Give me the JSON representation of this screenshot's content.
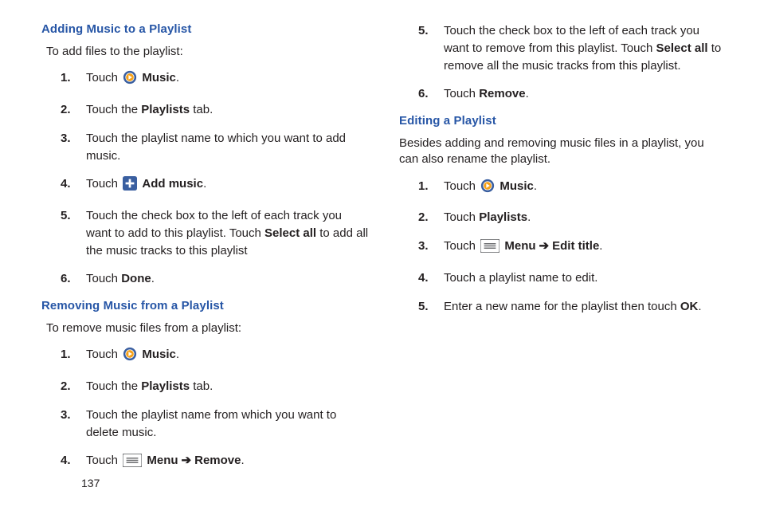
{
  "pageNumber": "137",
  "icons": {
    "music": "music-play-icon",
    "add": "add-plus-icon",
    "menu": "menu-bars-icon"
  },
  "left": {
    "adding": {
      "heading": "Adding Music to a Playlist",
      "intro": "To add files to the playlist:",
      "steps": {
        "s1": {
          "pre": "Touch ",
          "bold": "Music",
          "post": "."
        },
        "s2": {
          "pre": "Touch the ",
          "bold": "Playlists",
          "post": " tab."
        },
        "s3": {
          "text": "Touch the playlist name to which you want to add music."
        },
        "s4": {
          "pre": "Touch ",
          "bold": "Add music",
          "post": "."
        },
        "s5": {
          "pre": "Touch the check box to the left of each track you want to add to this playlist. Touch ",
          "bold": "Select all",
          "post": " to add all the music tracks to this playlist"
        },
        "s6": {
          "pre": "Touch ",
          "bold": "Done",
          "post": "."
        }
      }
    },
    "removing": {
      "heading": "Removing Music from a Playlist",
      "intro": "To remove music files from a playlist:",
      "steps": {
        "s1": {
          "pre": "Touch ",
          "bold": "Music",
          "post": "."
        },
        "s2": {
          "pre": "Touch the ",
          "bold": "Playlists",
          "post": " tab."
        },
        "s3": {
          "text": "Touch the playlist name from which you want to delete music."
        },
        "s4": {
          "pre": "Touch ",
          "bold1": "Menu",
          "arrow": "➔",
          "bold2": "Remove",
          "post": "."
        }
      }
    }
  },
  "right": {
    "continuation": {
      "s5": {
        "pre": "Touch the check box to the left of each track you want to remove from this playlist. Touch ",
        "bold": "Select all",
        "post": " to remove all the music tracks from this playlist."
      },
      "s6": {
        "pre": "Touch ",
        "bold": "Remove",
        "post": "."
      },
      "startAt": 5
    },
    "editing": {
      "heading": "Editing a Playlist",
      "intro": "Besides adding and removing music files in a playlist, you can also rename the playlist.",
      "steps": {
        "s1": {
          "pre": "Touch ",
          "bold": "Music",
          "post": "."
        },
        "s2": {
          "pre": "Touch ",
          "bold": "Playlists",
          "post": "."
        },
        "s3": {
          "pre": "Touch ",
          "bold1": "Menu",
          "arrow": "➔",
          "bold2": "Edit title",
          "post": "."
        },
        "s4": {
          "text": "Touch a playlist name to edit."
        },
        "s5": {
          "pre": "Enter a new name for the playlist then touch ",
          "bold": "OK",
          "post": "."
        }
      }
    }
  }
}
